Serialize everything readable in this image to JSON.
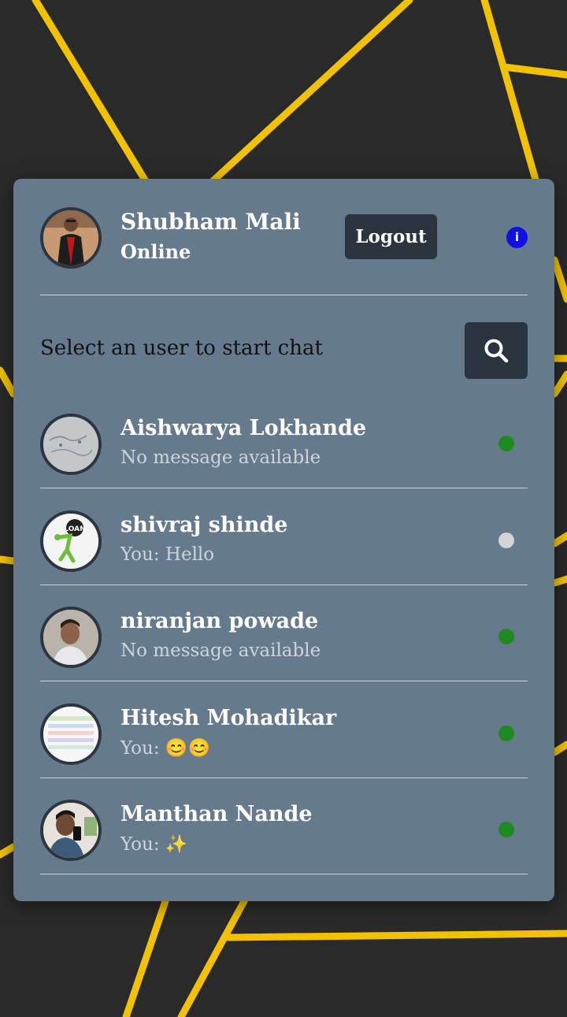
{
  "colors": {
    "online": "#1f8a1f",
    "offline": "#d4d4d4",
    "card_bg": "#657a8d",
    "button_bg": "#29343e",
    "accent_lines": "#f2c200",
    "info": "#1010e6"
  },
  "header": {
    "name": "Shubham Mali",
    "status": "Online",
    "logout_label": "Logout",
    "info_icon": "i"
  },
  "search": {
    "prompt": "Select an user to start chat",
    "icon": "search-icon"
  },
  "users": [
    {
      "name": "Aishwarya Lokhande",
      "last_message": "No message available",
      "status": "online"
    },
    {
      "name": "shivraj shinde",
      "last_message": "You: Hello",
      "status": "offline"
    },
    {
      "name": "niranjan powade",
      "last_message": "No message available",
      "status": "online"
    },
    {
      "name": "Hitesh Mohadikar",
      "last_message": "You: 😊😊",
      "status": "online"
    },
    {
      "name": "Manthan Nande",
      "last_message": "You: ✨",
      "status": "online"
    }
  ]
}
